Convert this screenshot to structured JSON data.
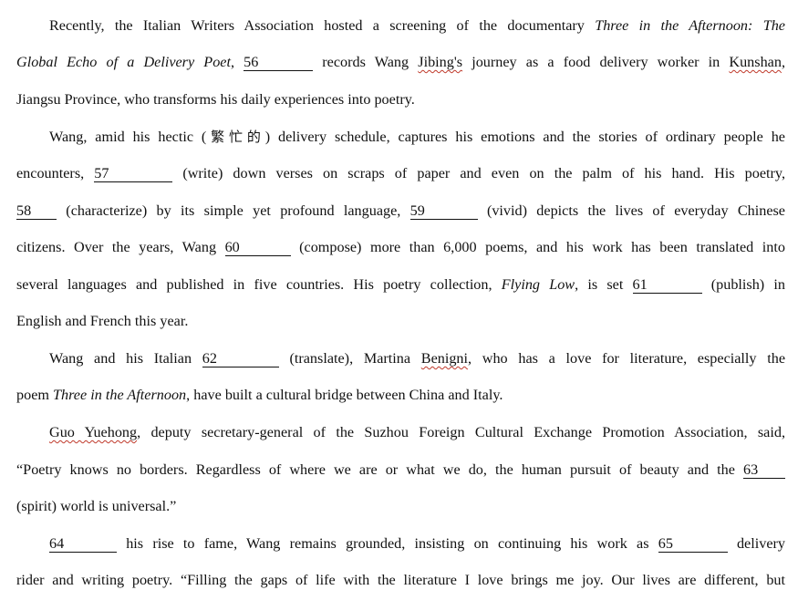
{
  "p1": {
    "l1_a": "Recently, the Italian Writers Association hosted a screening of the documentary ",
    "l1_title": "Three in the Afternoon: The",
    "l2_title": "Global Echo of a Delivery Poet",
    "l2_a": ", ",
    "b56": "56",
    "l2_b": " records Wang ",
    "name_jibing": "Jibing's",
    "l2_c": " journey as a food delivery worker in ",
    "kunshan": "Kunshan",
    "l2_d": ",",
    "l3": "Jiangsu Province, who transforms his daily experiences into poetry."
  },
  "p2": {
    "l4_a": "Wang, amid his hectic (",
    "l4_cjk": "繁忙的",
    "l4_b": ") delivery schedule, captures his emotions and the stories of ordinary people he",
    "l5_a": "encounters, ",
    "b57": "57",
    "l5_b": " (write) down verses on scraps of paper and even on the palm of his hand. His poetry,",
    "b58": "58",
    "l6_a": " (characterize) by its simple yet profound language, ",
    "b59": "59",
    "l6_b": " (vivid) depicts the lives of everyday Chinese",
    "l7_a": "citizens. Over the years, Wang ",
    "b60": "60",
    "l7_b": " (compose) more than 6,000 poems, and his work has been translated into",
    "l8_a": "several languages and published in five countries. His poetry collection, ",
    "l8_title": "Flying Low",
    "l8_b": ", is set ",
    "b61": "61",
    "l8_c": " (publish) in",
    "l9": "English and French this year."
  },
  "p3": {
    "l10_a": "Wang and his Italian ",
    "b62": "62",
    "l10_b": " (translate), Martina ",
    "benigni": "Benigni",
    "l10_c": ", who has a love for literature, especially the",
    "l11_a": "poem ",
    "l11_title": "Three in the Afternoon",
    "l11_b": ", have built a cultural bridge between China and Italy."
  },
  "p4": {
    "guo": "Guo Yuehong",
    "l12_a": ", deputy secretary-general of the Suzhou Foreign Cultural Exchange Promotion Association, said,",
    "l13_a": "“Poetry knows no borders. Regardless of where we are or what we do, the human pursuit of beauty and the ",
    "b63": "63",
    "l14": "(spirit) world is universal.”"
  },
  "p5": {
    "b64": "64",
    "l15_a": " his rise to fame, Wang remains grounded, insisting on continuing his work as ",
    "b65": "65",
    "l15_b": " delivery",
    "l16": "rider and writing poetry. “Filling the gaps of life with the literature I love brings me joy. Our lives are different, but"
  }
}
